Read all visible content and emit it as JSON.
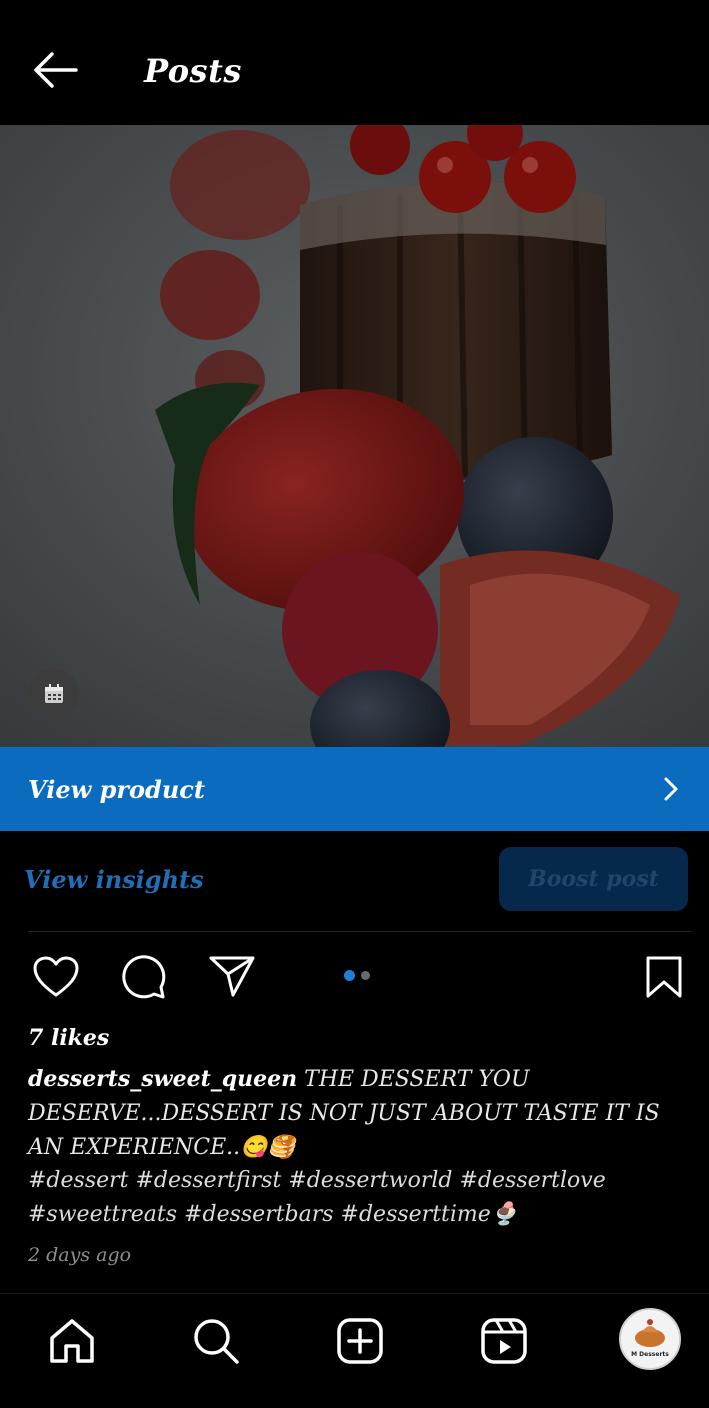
{
  "header": {
    "title": "Posts",
    "back_icon": "arrow-left-icon"
  },
  "post": {
    "view_product_label": "View product",
    "view_insights_label": "View insights",
    "boost_label": "Boost post",
    "carousel": {
      "count": 2,
      "active": 1,
      "active_color": "#1f7fd6",
      "inactive_color": "#6b6b6b"
    },
    "likes": "7 likes",
    "username": "desserts_sweet_queen",
    "caption": "THE DESSERT YOU DESERVE...DESSERT IS NOT JUST ABOUT TASTE IT IS AN EXPERIENCE..😋🥞",
    "hashtags": "#dessert #dessertfirst #dessertworld #dessertlove #sweettreats #dessertbars #desserttime🍨",
    "time_ago": "2 days ago"
  },
  "avatar": {
    "text": "M Desserts"
  },
  "colors": {
    "accent": "#0b6cbf",
    "boost_bg": "#06284a",
    "background": "#000000"
  }
}
